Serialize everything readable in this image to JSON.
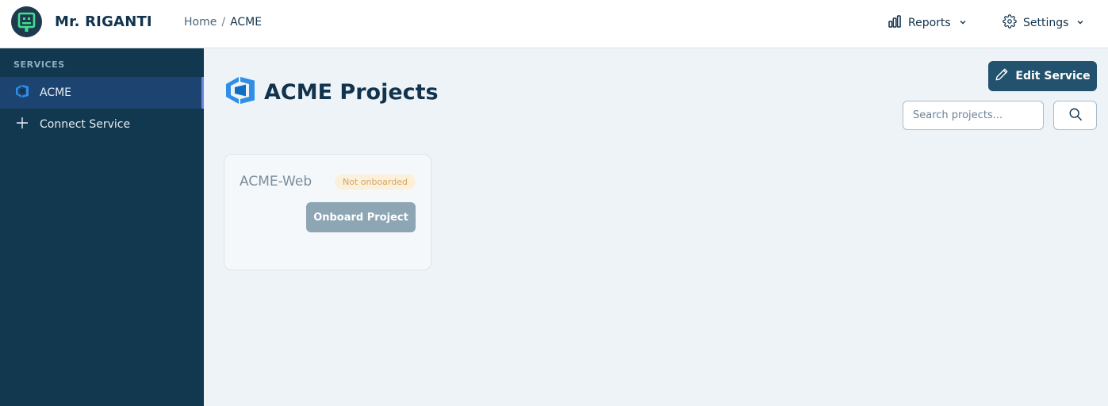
{
  "header": {
    "brand": "Mr. RIGANTI",
    "breadcrumb": {
      "home": "Home",
      "separator": "/",
      "current": "ACME"
    },
    "menus": [
      {
        "label": "Reports",
        "icon": "bar-chart-icon"
      },
      {
        "label": "Settings",
        "icon": "gear-icon"
      }
    ]
  },
  "sidebar": {
    "heading": "SERVICES",
    "items": [
      {
        "label": "ACME",
        "icon": "azure-devops-icon",
        "active": true
      },
      {
        "label": "Connect Service",
        "icon": "plus-icon",
        "active": false
      }
    ]
  },
  "main": {
    "title": "ACME Projects",
    "edit_button": "Edit Service",
    "search": {
      "placeholder": "Search projects...",
      "value": ""
    }
  },
  "projects": [
    {
      "name": "ACME-Web",
      "status": "Not onboarded",
      "action": "Onboard Project"
    }
  ],
  "colors": {
    "sidebar_bg": "#12384f",
    "sidebar_active": "#1d4370",
    "primary_button": "#23526e",
    "page_bg": "#edf3f7",
    "badge_bg": "#fbf0da",
    "badge_text": "#d3a56a",
    "logo_accent": "#3ee08f",
    "azure_blue": "#2f8ee5"
  }
}
